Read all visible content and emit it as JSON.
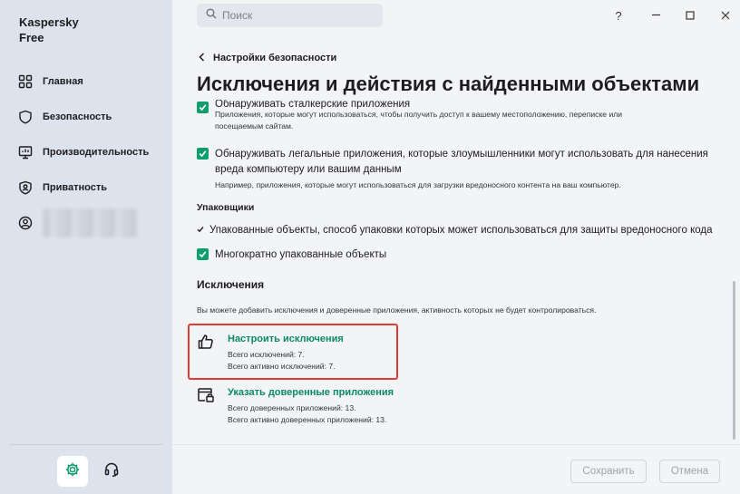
{
  "app": {
    "brand_line1": "Kaspersky",
    "brand_line2": "Free"
  },
  "sidebar": {
    "items": [
      {
        "label": "Главная",
        "icon": "home-grid-icon"
      },
      {
        "label": "Безопасность",
        "icon": "shield-icon"
      },
      {
        "label": "Производительность",
        "icon": "monitor-icon"
      },
      {
        "label": "Приватность",
        "icon": "privacy-shield-icon"
      }
    ],
    "account_icon": "user-avatar-icon",
    "settings_icon": "gear-icon",
    "support_icon": "headset-icon"
  },
  "topbar": {
    "search_placeholder": "Поиск",
    "help": "?",
    "minimize": "—",
    "maximize": "☐",
    "close": "✕"
  },
  "breadcrumb": {
    "back_label": "Настройки безопасности"
  },
  "page": {
    "title": "Исключения и действия с найденными объектами"
  },
  "detect": [
    {
      "checked": true,
      "label": "Обнаруживать сталкерские приложения",
      "desc_line1": "Приложения, которые могут использоваться, чтобы получить доступ к вашему местоположению, переписке или",
      "desc_line2": "посещаемым сайтам."
    },
    {
      "checked": true,
      "label_line1": "Обнаруживать легальные приложения, которые злоумышленники могут использовать для нанесения",
      "label_line2": "вреда компьютеру или вашим данным",
      "desc_line1": "Например, приложения, которые могут использоваться для загрузки вредоносного контента на ваш компьютер."
    }
  ],
  "packers": {
    "heading": "Упаковщики",
    "packed_objects": "Упакованные объекты, способ упаковки которых может использоваться для защиты вредоносного кода",
    "multi_packed": {
      "checked": true,
      "label": "Многократно упакованные объекты"
    }
  },
  "exclusions": {
    "heading": "Исключения",
    "info": "Вы можете добавить исключения и доверенные приложения, активность которых не будет контролироваться.",
    "configure": {
      "title": "Настроить исключения",
      "total": "Всего исключений: 7.",
      "active": "Всего активно исключений: 7.",
      "icon": "thumbs-up-icon"
    },
    "trusted": {
      "title": "Указать доверенные приложения",
      "total": "Всего доверенных приложений: 13.",
      "active": "Всего активно доверенных приложений: 13.",
      "icon": "trusted-app-lock-icon"
    }
  },
  "footer": {
    "save": "Сохранить",
    "cancel": "Отмена"
  },
  "colors": {
    "accent": "#0f9d6e",
    "link": "#0b8a63",
    "highlight": "#e03a3a",
    "sidebar": "#dde3ec"
  }
}
